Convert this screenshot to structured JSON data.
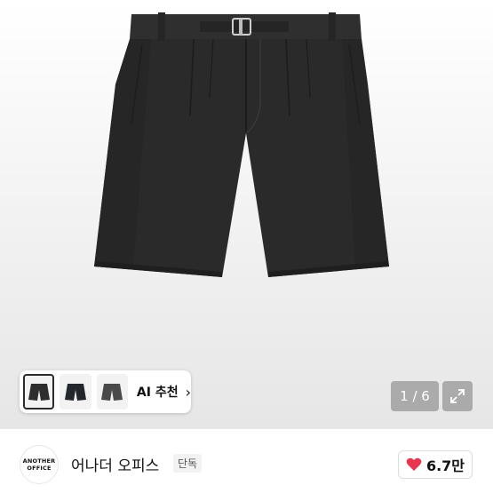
{
  "gallery": {
    "counter": "1 / 6",
    "ai_recommend_label": "AI 추천",
    "ai_recommend_chevron": "›",
    "thumbnails": [
      "thumbnail-1",
      "thumbnail-2",
      "thumbnail-3"
    ]
  },
  "brand": {
    "logo_line1": "ANOTHER",
    "logo_line2": "OFFICE",
    "name": "어나더 오피스",
    "badge": "단독"
  },
  "likes": {
    "count": "6.7만",
    "icon": "heart-icon",
    "color": "#e8344e"
  },
  "icons": {
    "expand": "expand-icon"
  }
}
